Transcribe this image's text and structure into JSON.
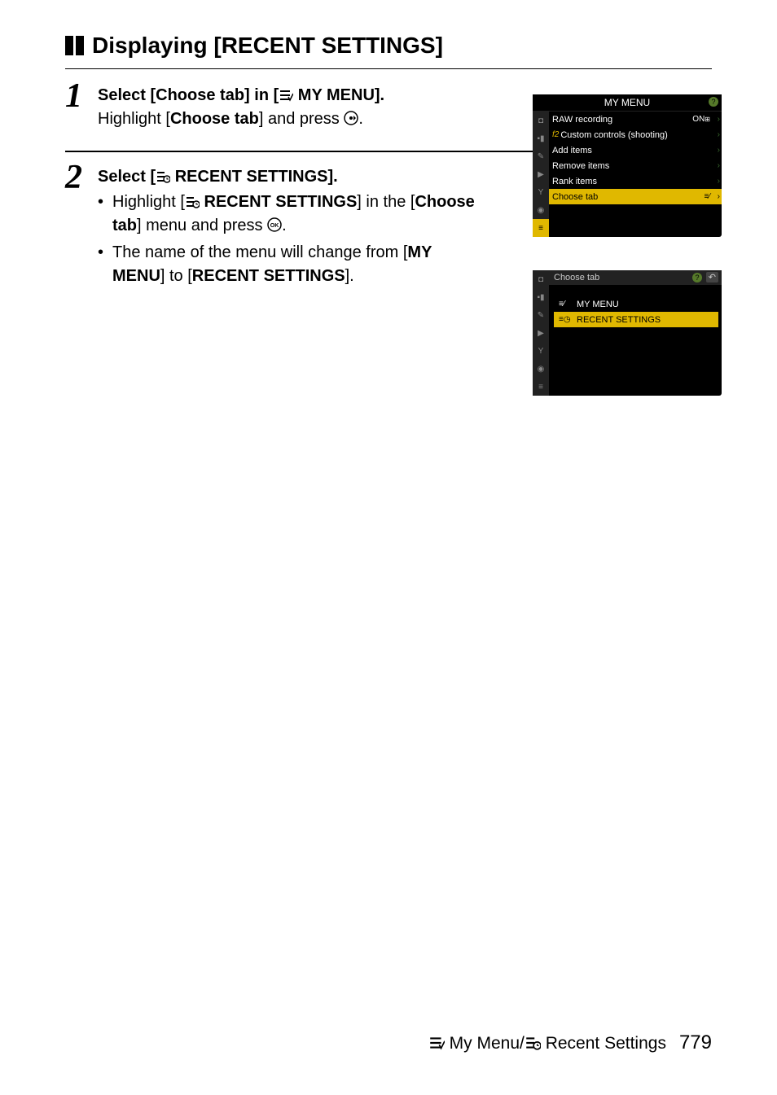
{
  "heading": "Displaying [RECENT SETTINGS]",
  "steps": [
    {
      "num": "1",
      "title_pre": "Select [Choose tab] in [",
      "title_icon": "my-menu-icon",
      "title_post": "  MY MENU].",
      "body_pre": "Highlight [",
      "body_bold": "Choose tab",
      "body_post": "] and press ",
      "body_icon": "right-selector-icon",
      "body_end": "."
    },
    {
      "num": "2",
      "title_pre": "Select [",
      "title_icon": "recent-settings-icon",
      "title_post": "  RECENT SETTINGS].",
      "bullets": [
        {
          "seg1": "Highlight [",
          "icon": "recent-settings-icon",
          "seg2": "  ",
          "bold1": "RECENT SETTINGS",
          "seg3": "] in the [",
          "bold2": "Choose tab",
          "seg4": "] menu and press ",
          "endicon": "ok-icon",
          "seg5": "."
        },
        {
          "seg1": "The name of the menu will change from [",
          "bold1": "MY MENU",
          "seg3": "] to [",
          "bold2": "RECENT SETTINGS",
          "seg4": "].",
          "seg5": ""
        }
      ]
    }
  ],
  "screenshot1": {
    "title": "MY MENU",
    "rows": [
      {
        "label": "RAW recording",
        "value": "ON",
        "val_icon": "raw-suffix-icon"
      },
      {
        "prefix": "f2",
        "label": "Custom controls (shooting)"
      },
      {
        "label": "Add items"
      },
      {
        "label": "Remove items"
      },
      {
        "label": "Rank items"
      },
      {
        "label": "Choose tab",
        "highlight": true,
        "right_icon": "my-menu-icon"
      }
    ]
  },
  "screenshot2": {
    "title": "Choose tab",
    "options": [
      {
        "icon": "my-menu-icon",
        "label": "MY MENU"
      },
      {
        "icon": "recent-settings-icon",
        "label": "RECENT SETTINGS",
        "highlight": true
      }
    ]
  },
  "footer": {
    "left_icon": "my-menu-icon",
    "left_text": " My Menu/",
    "right_icon": "recent-settings-icon",
    "right_text": " Recent Settings",
    "page": "779"
  }
}
